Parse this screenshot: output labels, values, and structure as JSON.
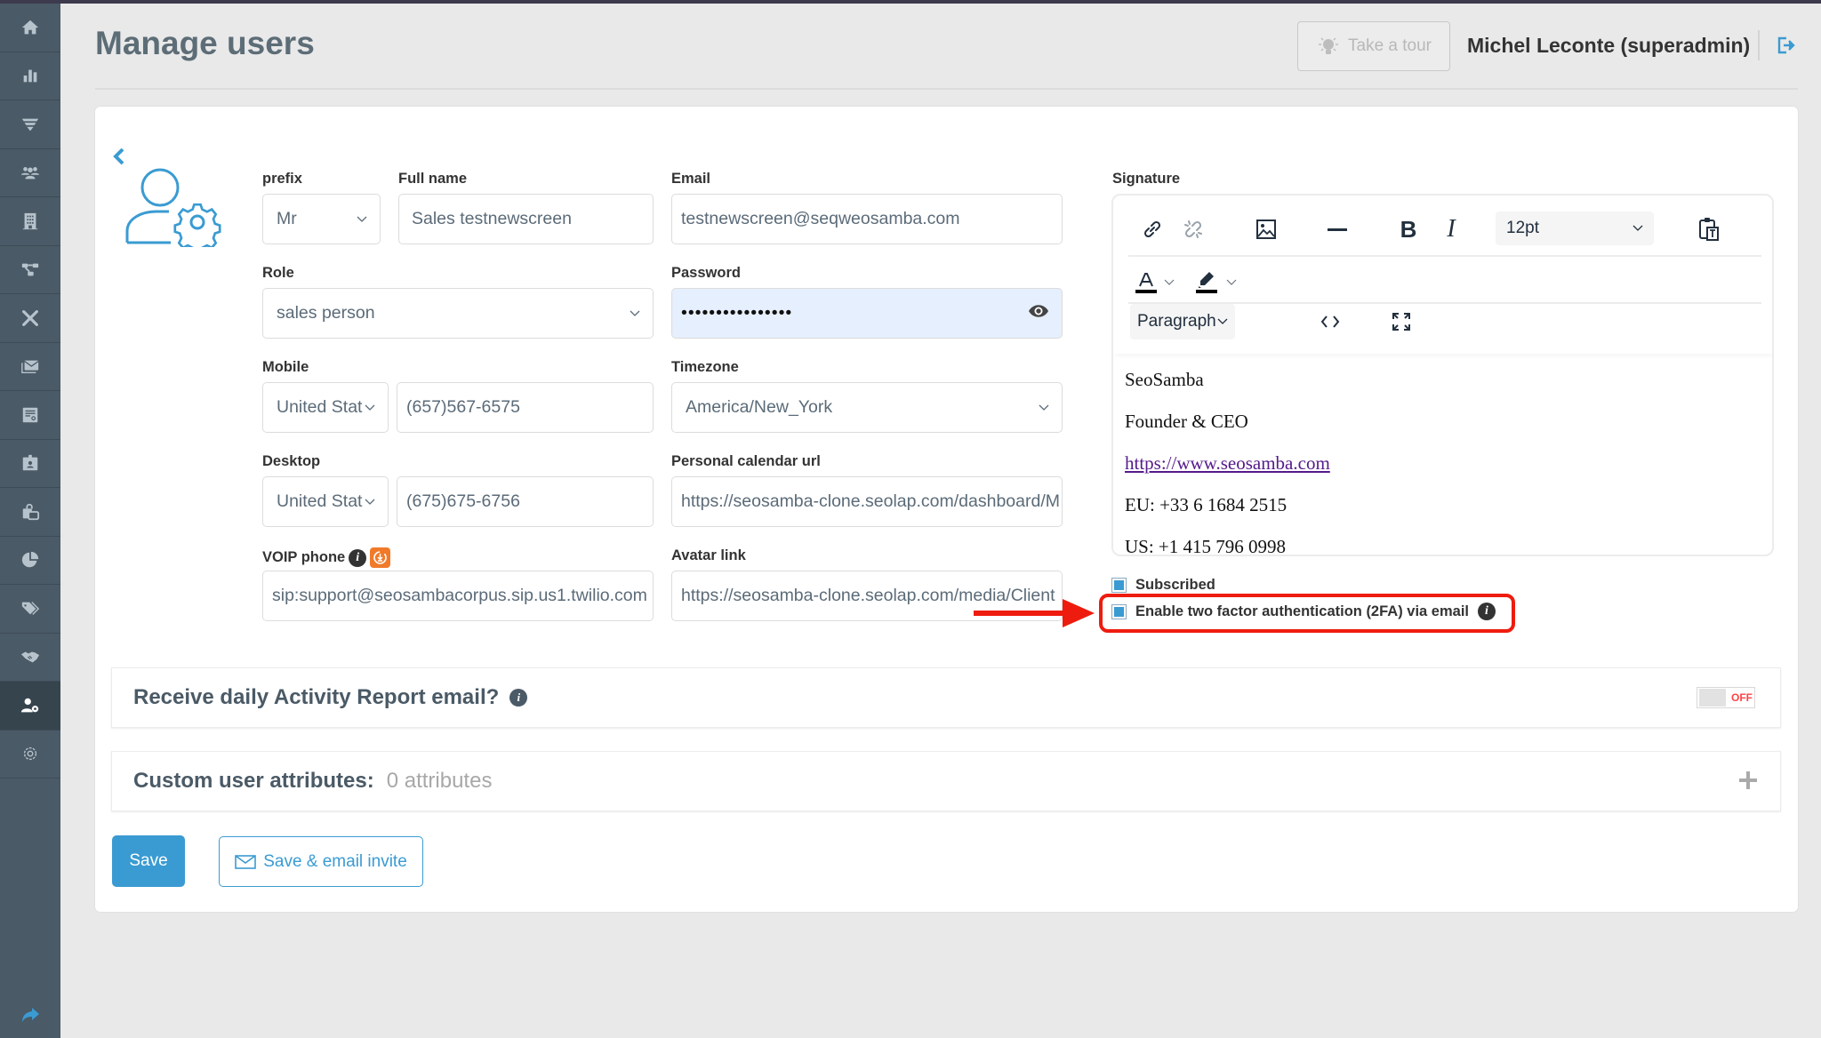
{
  "header": {
    "title": "Manage users",
    "tour_button": "Take a tour",
    "user_name": "Michel Leconte (superadmin)"
  },
  "sidebar": {
    "items": [
      {
        "icon": "home-icon"
      },
      {
        "icon": "bar-chart-icon"
      },
      {
        "icon": "funnel-icon"
      },
      {
        "icon": "users-group-icon"
      },
      {
        "icon": "building-icon"
      },
      {
        "icon": "sitemap-icon"
      },
      {
        "icon": "tools-icon"
      },
      {
        "icon": "envelopes-icon"
      },
      {
        "icon": "report-search-icon"
      },
      {
        "icon": "id-badge-icon"
      },
      {
        "icon": "shopping-bag-icon"
      },
      {
        "icon": "pie-chart-icon"
      },
      {
        "icon": "tags-icon"
      },
      {
        "icon": "handshake-icon"
      },
      {
        "icon": "user-gear-icon",
        "active": true
      },
      {
        "icon": "gear-icon"
      }
    ],
    "bottom_icon": "share-arrow-icon"
  },
  "form": {
    "prefix": {
      "label": "prefix",
      "value": "Mr"
    },
    "full_name": {
      "label": "Full name",
      "value": "Sales testnewscreen"
    },
    "email": {
      "label": "Email",
      "value": "testnewscreen@seqweosamba.com"
    },
    "role": {
      "label": "Role",
      "value": "sales person"
    },
    "password": {
      "label": "Password",
      "value": "••••••••••••••••"
    },
    "mobile": {
      "label": "Mobile",
      "country": "United Stat",
      "value": "(657)567-6575"
    },
    "timezone": {
      "label": "Timezone",
      "value": "America/New_York"
    },
    "desktop": {
      "label": "Desktop",
      "country": "United Stat",
      "value": "(675)675-6756"
    },
    "calendar_url": {
      "label": "Personal calendar url",
      "value": "https://seosamba-clone.seolap.com/dashboard/M"
    },
    "voip": {
      "label": "VOIP phone",
      "value": "sip:support@seosambacorpus.sip.us1.twilio.com"
    },
    "avatar_link": {
      "label": "Avatar link",
      "value": "https://seosamba-clone.seolap.com/media/Client"
    }
  },
  "signature": {
    "label": "Signature",
    "font_size": "12pt",
    "block_format": "Paragraph",
    "lines": [
      "SeoSamba",
      "Founder & CEO",
      "https://www.seosamba.com",
      "EU: +33 6 1684 2515",
      "US: +1 415 796 0998"
    ]
  },
  "checkboxes": {
    "subscribed": {
      "label": "Subscribed",
      "checked": true
    },
    "two_factor": {
      "label": "Enable two factor authentication (2FA) via email",
      "checked": true
    }
  },
  "panels": {
    "activity_report": {
      "title": "Receive daily Activity Report email?",
      "toggle": "OFF"
    },
    "custom_attributes": {
      "title": "Custom user attributes:",
      "count": "0 attributes"
    }
  },
  "buttons": {
    "save": "Save",
    "save_invite": "Save & email invite"
  },
  "colors": {
    "accent": "#3a9bd2",
    "sidebar": "#4a5a66",
    "annotation": "#ee1c0e",
    "toggle_off": "#ff4444"
  }
}
